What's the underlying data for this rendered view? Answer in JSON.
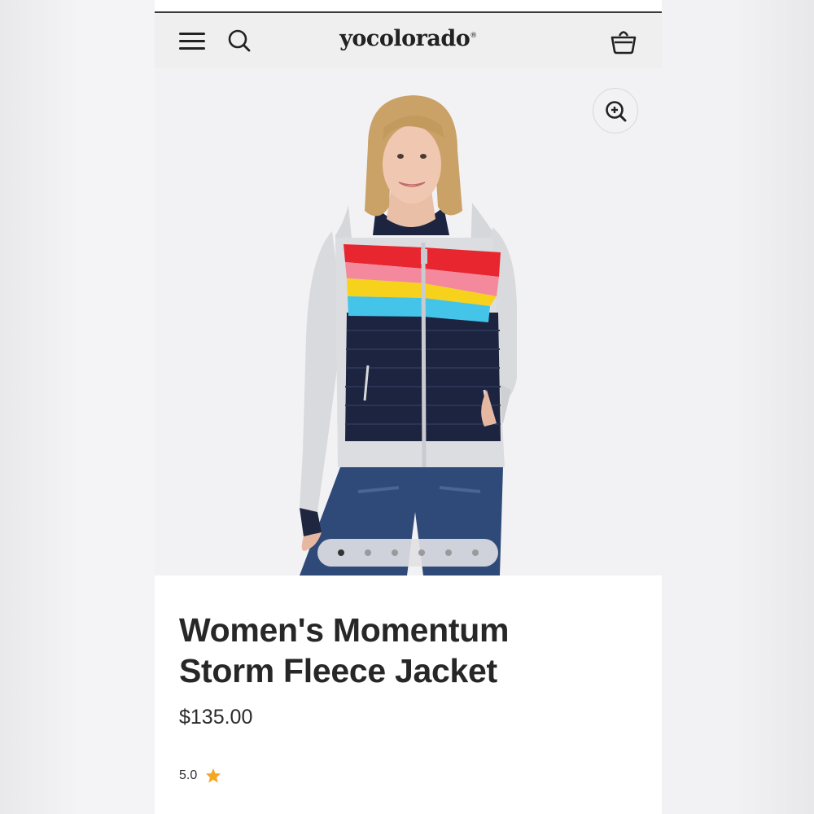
{
  "header": {
    "logo_text": "yocolorado",
    "logo_mark": "®",
    "icons": [
      "hamburger-menu-icon",
      "search-icon",
      "shopping-basket-icon"
    ]
  },
  "gallery": {
    "image_count": 6,
    "active_index": 0,
    "zoom_icon": "zoom-in-icon"
  },
  "product": {
    "title_line1": "Women's Momentum",
    "title_line2": "Storm Fleece Jacket",
    "price": "$135.00",
    "rating": "5.0",
    "rating_icon": "star-icon"
  },
  "colors": {
    "star": "#f5a623",
    "jacket_red": "#e8262f",
    "jacket_pink": "#f4899e",
    "jacket_yellow": "#f7d21c",
    "jacket_cyan": "#45c4ea",
    "jacket_navy": "#1c2440"
  }
}
